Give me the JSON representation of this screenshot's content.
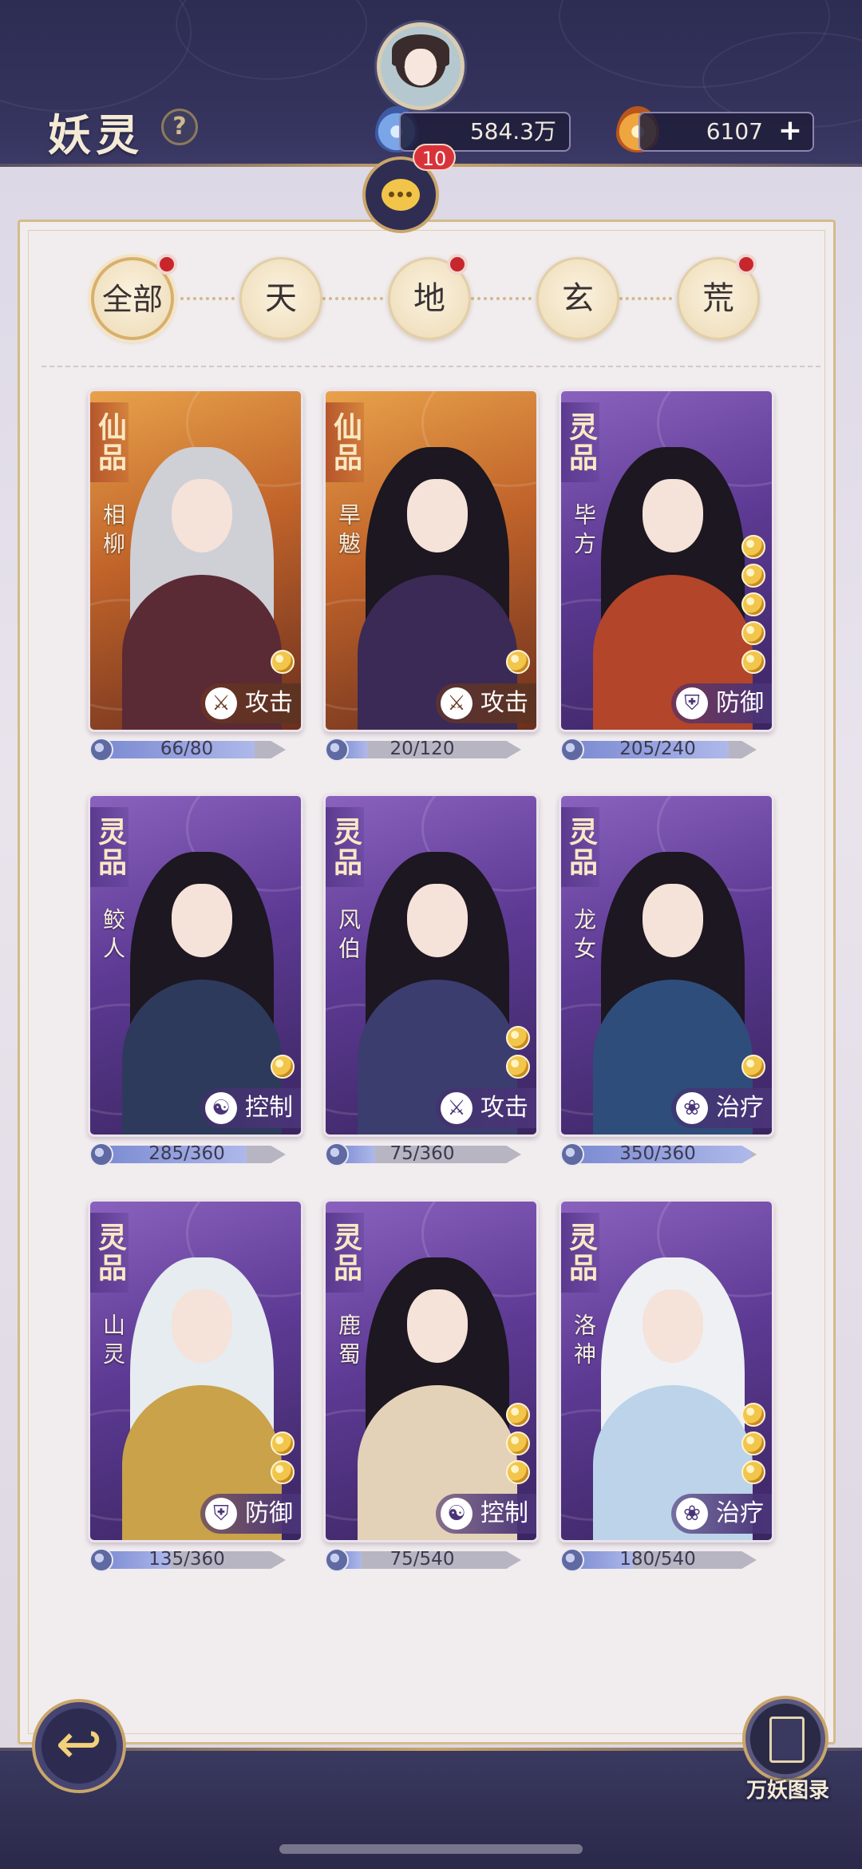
{
  "header": {
    "title": "妖灵",
    "help_label": "?",
    "currency_1": "584.3万",
    "currency_2": "6107",
    "plus_label": "+",
    "chat_badge": "10"
  },
  "tabs": [
    {
      "label": "全部",
      "active": true,
      "dot": true
    },
    {
      "label": "天",
      "active": false,
      "dot": false
    },
    {
      "label": "地",
      "active": false,
      "dot": true
    },
    {
      "label": "玄",
      "active": false,
      "dot": false
    },
    {
      "label": "荒",
      "active": false,
      "dot": true
    }
  ],
  "cards": [
    {
      "grade": "仙品",
      "name": "相柳",
      "role": "攻击",
      "role_icon": "⚔",
      "tier": "xian",
      "yinyang": 1,
      "fragments": "66/80",
      "progress": 0.825
    },
    {
      "grade": "仙品",
      "name": "旱魃",
      "role": "攻击",
      "role_icon": "⚔",
      "tier": "xian",
      "yinyang": 1,
      "fragments": "20/120",
      "progress": 0.167
    },
    {
      "grade": "灵品",
      "name": "毕方",
      "role": "防御",
      "role_icon": "⛨",
      "tier": "ling",
      "yinyang": 5,
      "fragments": "205/240",
      "progress": 0.854
    },
    {
      "grade": "灵品",
      "name": "鲛人",
      "role": "控制",
      "role_icon": "☯",
      "tier": "ling",
      "yinyang": 1,
      "fragments": "285/360",
      "progress": 0.792
    },
    {
      "grade": "灵品",
      "name": "风伯",
      "role": "攻击",
      "role_icon": "⚔",
      "tier": "ling",
      "yinyang": 2,
      "fragments": "75/360",
      "progress": 0.208
    },
    {
      "grade": "灵品",
      "name": "龙女",
      "role": "治疗",
      "role_icon": "❀",
      "tier": "ling",
      "yinyang": 1,
      "fragments": "350/360",
      "progress": 0.972
    },
    {
      "grade": "灵品",
      "name": "山灵",
      "role": "防御",
      "role_icon": "⛨",
      "tier": "ling",
      "yinyang": 2,
      "fragments": "135/360",
      "progress": 0.375
    },
    {
      "grade": "灵品",
      "name": "鹿蜀",
      "role": "控制",
      "role_icon": "☯",
      "tier": "ling",
      "yinyang": 3,
      "fragments": "75/540",
      "progress": 0.139
    },
    {
      "grade": "灵品",
      "name": "洛神",
      "role": "治疗",
      "role_icon": "❀",
      "tier": "ling",
      "yinyang": 3,
      "fragments": "180/540",
      "progress": 0.333
    }
  ],
  "footer": {
    "back_label": "↩",
    "bestiary_label": "万妖图录"
  },
  "colors": {
    "header_bg": "#2d2c52",
    "gold_accent": "#c9a56a",
    "xian_card": "#c0632a",
    "ling_card": "#5d3a94",
    "badge_red": "#d8333a"
  }
}
